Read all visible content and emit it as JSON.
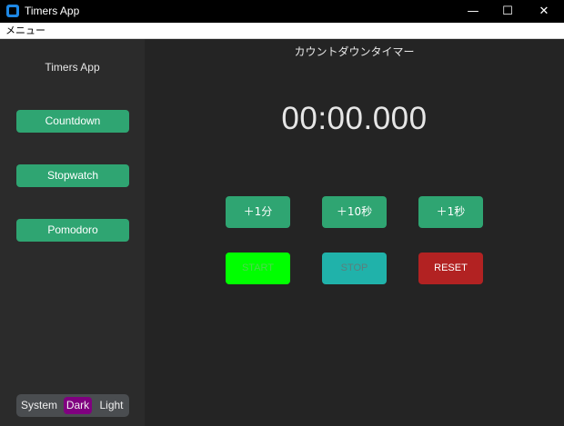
{
  "window": {
    "title": "Timers App",
    "controls": {
      "minimize": "—",
      "maximize": "☐",
      "close": "✕"
    }
  },
  "menubar": {
    "menu_label": "メニュー"
  },
  "sidebar": {
    "title": "Timers App",
    "buttons": [
      {
        "label": "Countdown"
      },
      {
        "label": "Stopwatch"
      },
      {
        "label": "Pomodoro"
      }
    ],
    "appearance": {
      "options": [
        "System",
        "Dark",
        "Light"
      ],
      "selected": "Dark"
    }
  },
  "main": {
    "title": "カウントダウンタイマー",
    "time_display": "00:00.000",
    "add_buttons": [
      {
        "label": "＋1分"
      },
      {
        "label": "＋10秒"
      },
      {
        "label": "＋1秒"
      }
    ],
    "controls": {
      "start": "START",
      "stop": "STOP",
      "reset": "RESET"
    }
  },
  "colors": {
    "accent_green": "#2fa572",
    "start_button": "#00ff00",
    "start_text_disabled": "#4cd84c",
    "stop_button": "#20b2aa",
    "stop_text_disabled": "#5a7f7d",
    "reset_button": "#b22222",
    "selected_segment": "#800080",
    "sidebar_bg": "#2b2b2b",
    "main_bg": "#242424"
  }
}
